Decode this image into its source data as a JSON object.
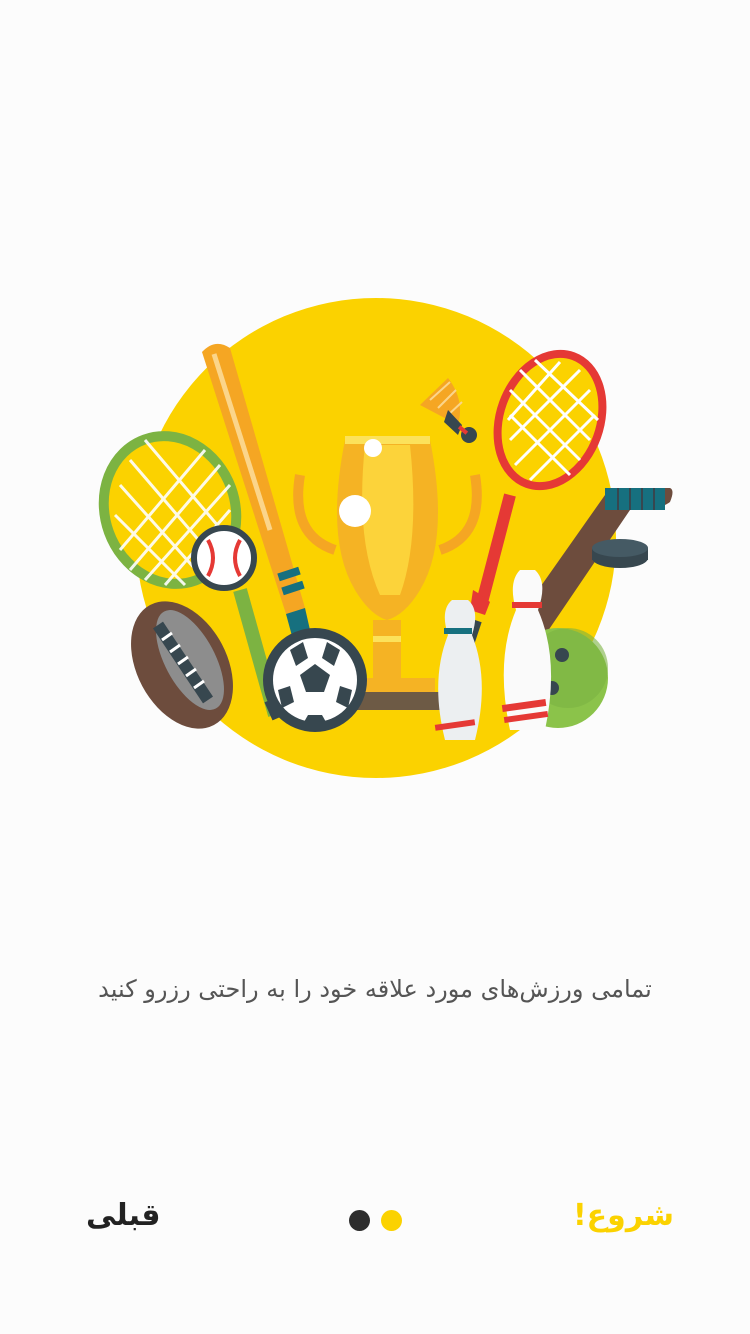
{
  "onboarding": {
    "caption": "تمامی ورزش‌های مورد علاقه خود را به راحتی رزرو کنید",
    "illustration_icon": "sports-equipment-illustration"
  },
  "nav": {
    "start_label": "شروع!",
    "previous_label": "قبلی"
  },
  "pagination": {
    "total": 2,
    "current": 2,
    "dots": [
      {
        "state": "inactive",
        "color": "#2d2d2d"
      },
      {
        "state": "active",
        "color": "#fbd200"
      }
    ]
  },
  "colors": {
    "accent": "#fbd200",
    "text": "#555555",
    "background": "#fcfcfc"
  }
}
